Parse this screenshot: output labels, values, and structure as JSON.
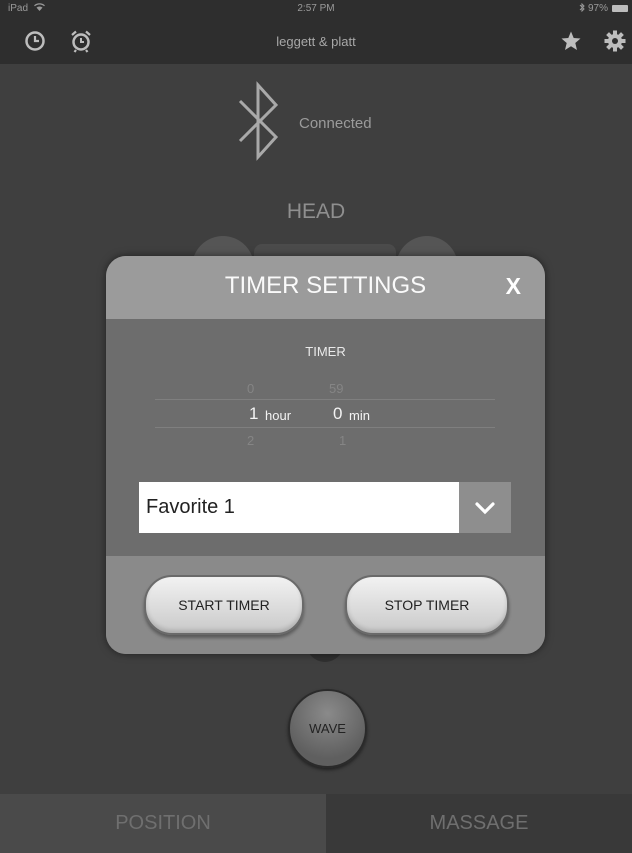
{
  "status_bar": {
    "device": "iPad",
    "time": "2:57 PM",
    "battery": "97%"
  },
  "nav": {
    "title": "leggett & platt"
  },
  "connection": {
    "status": "Connected"
  },
  "section": {
    "head_label": "HEAD"
  },
  "modal": {
    "title": "TIMER SETTINGS",
    "close_label": "X",
    "picker_label": "TIMER",
    "hours": {
      "prev": "0",
      "selected": "1",
      "next": "2",
      "unit": "hour"
    },
    "minutes": {
      "prev": "59",
      "selected": "0",
      "next": "1",
      "unit": "min"
    },
    "favorite": {
      "value": "Favorite 1"
    },
    "start_label": "START TIMER",
    "stop_label": "STOP TIMER"
  },
  "wave_label": "WAVE",
  "tabs": [
    {
      "label": "POSITION",
      "active": true
    },
    {
      "label": "MASSAGE",
      "active": false
    }
  ]
}
